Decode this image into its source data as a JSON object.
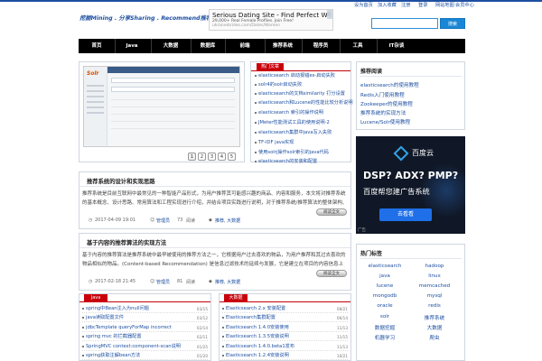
{
  "header": {
    "logo": "挖掘Mining . 分享Sharing . Recommend推荐 ...",
    "top_links": [
      "设为首页",
      "加入收藏",
      "注册",
      "登录",
      "网站地图",
      "会员中心"
    ],
    "search": {
      "placeholder": "",
      "button": "搜索"
    }
  },
  "ad": {
    "headline": "Serious Dating Site - Find Perfect Woman",
    "sub": "29,000+ Real Female Profiles. Join Free!",
    "url": "ukrainebrides.com/Dates/Women",
    "close": "ⓘ ✕"
  },
  "nav": {
    "items": [
      "首页",
      "Java",
      "大数据",
      "数据库",
      "前端",
      "推荐系统",
      "程序员",
      "工具",
      "IT杂谈"
    ]
  },
  "slider": {
    "logo_text": "Solr",
    "pages": [
      "1",
      "2",
      "3",
      "4",
      "5"
    ]
  },
  "hot": {
    "title": "热门文章",
    "items": [
      "elasticsearch 启动报错es-启动失败",
      "solr4的solr启动失败",
      "elasticsearch的文档similarity 打分设置",
      "elasticsearch和Lucene的性能比较分析说明",
      "elasticsearch 索引的操作说明",
      "JMeter性能测试工具的使用说明-2",
      "elasticsearch集群中java写入失败",
      "TF-IDF java实现",
      "使用solrj操作solr索引的java代码",
      "elasticsearch的安装和配置"
    ]
  },
  "articles": [
    {
      "title": "推荐系统的设计和实现思路",
      "desc": "推荐系统是目前互联网中最常见的一种智能产品形式，为用户推荐其可能感兴趣的商品、内容和服务，本文将对推荐系统的基本概念、设计思路、常用算法和工程实现进行介绍，并结合项目实践进行说明，对于推荐系统/推荐算法的整体架构、召回、排序以及评估等关键环节进行简要的分析和介绍，希望对大家有所帮助...",
      "date": "2017-04-09 19:01",
      "author": "管理员",
      "views": "73",
      "views_label": "阅读",
      "category": "推荐, 大数据",
      "more": "阅读全文"
    },
    {
      "title": "基于内容的推荐算法的实现方法",
      "desc": "基于内容的推荐算法是推荐系统中最早被使用的推荐方法之一，它根据用户过去喜欢的物品，为用户推荐和其过去喜欢的物品相似的物品。(Content-based Recommendation) 是信息过滤技术的延续与发展，它是建立在项目的内容信息上作出推荐的，而不需要依据用户对项目的评价意见，更多地需要用机器学习的方法从关于内容的特征描述的事例中得到用户的兴趣资料...",
      "date": "2017-02-18 21:45",
      "author": "管理员",
      "views": "81",
      "views_label": "阅读",
      "category": "推荐, 大数据",
      "more": "阅读全文"
    }
  ],
  "list_java": {
    "title": "Java",
    "items": [
      {
        "t": "spring中Bean注入为null问题",
        "d": "03/15"
      },
      {
        "t": "java读取配置文件",
        "d": "03/12"
      },
      {
        "t": "jdbcTemplate queryForMap incorrect",
        "d": "02/14"
      },
      {
        "t": "spring mvc 的拦截器配置",
        "d": "02/11"
      },
      {
        "t": "SpringMVC context:component-scan说明",
        "d": "01/25"
      },
      {
        "t": "spring获取注解bean方法",
        "d": "01/20"
      }
    ]
  },
  "list_bigdata": {
    "title": "大数据",
    "items": [
      {
        "t": "Elasticsearch 2.x 安装配置",
        "d": "08/21"
      },
      {
        "t": "Elasticsearch集群配置",
        "d": "06/14"
      },
      {
        "t": "Elasticsearch 1.4.0安装使用",
        "d": "11/13"
      },
      {
        "t": "Elasticsearch 1.3.5安装说明",
        "d": "11/15"
      },
      {
        "t": "Elasticsearch 1.4.0.beta1发布",
        "d": "11/13"
      },
      {
        "t": "Elasticsearch 1.2.4安装说明",
        "d": "10/21"
      }
    ]
  },
  "side_recommend": {
    "title": "推荐阅读",
    "items": [
      "elasticsearch的使用教程",
      "Redis入门使用教程",
      "Zookeeper的使用教程",
      "推荐系统的实现方法",
      "Lucene/Solr使用教程"
    ]
  },
  "baidu_ad": {
    "brand": "百度云",
    "question": "DSP? ADX? PMP?",
    "slogan": "百度帮您建广告系统",
    "button": "去看看",
    "ad_label": "广告"
  },
  "tags": {
    "title": "热门标签",
    "items": [
      "elasticsearch",
      "hadoop",
      "java",
      "linux",
      "lucene",
      "memcached",
      "mongodb",
      "mysql",
      "oracle",
      "redis",
      "solr",
      "推荐系统",
      "数据挖掘",
      "大数据",
      "机器学习",
      "爬虫"
    ]
  },
  "colors": {
    "brand": "#1e50a2",
    "accent": "#c9000b",
    "nav_bg": "#000000",
    "search_btn": "#1a87d6"
  }
}
